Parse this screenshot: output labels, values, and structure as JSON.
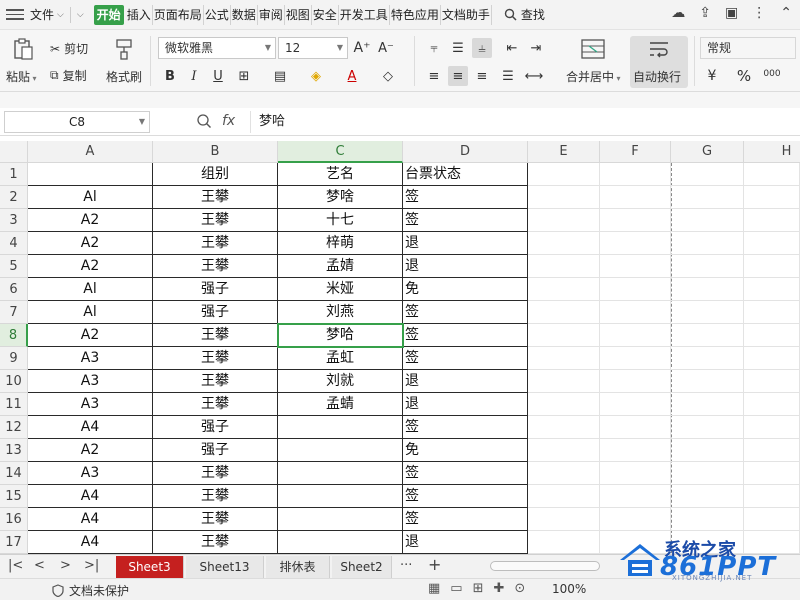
{
  "menubar": {
    "file_label": "文件",
    "tabs": [
      "开始",
      "插入",
      "页面布局",
      "公式",
      "数据",
      "审阅",
      "视图",
      "安全",
      "开发工具",
      "特色应用",
      "文档助手"
    ],
    "active_tab": "开始",
    "search_label": "查找"
  },
  "ribbon": {
    "paste_label": "粘贴",
    "cut_label": "剪切",
    "copy_label": "复制",
    "format_painter_label": "格式刷",
    "font_name": "微软雅黑",
    "font_size": "12",
    "merge_center_label": "合并居中",
    "auto_wrap_label": "自动换行",
    "number_format": "常规",
    "percent_symbol": "%",
    "thousand_symbol": "000"
  },
  "formula_bar": {
    "cell_ref": "C8",
    "fx_label": "fx",
    "content": "梦哈"
  },
  "grid": {
    "columns": [
      "A",
      "B",
      "C",
      "D",
      "E",
      "F",
      "G",
      "H"
    ],
    "selected_column": "C",
    "selected_row": 8,
    "rows": [
      {
        "num": "1",
        "a": "",
        "b": "组别",
        "c": "艺名",
        "d": "台票状态"
      },
      {
        "num": "2",
        "a": "Al",
        "b": "王攀",
        "c": "梦啥",
        "d": "签"
      },
      {
        "num": "3",
        "a": "A2",
        "b": "王攀",
        "c": "十七",
        "d": "签"
      },
      {
        "num": "4",
        "a": "A2",
        "b": "王攀",
        "c": "梓萌",
        "d": "退"
      },
      {
        "num": "5",
        "a": "A2",
        "b": "王攀",
        "c": "孟婧",
        "d": "退"
      },
      {
        "num": "6",
        "a": "Al",
        "b": "强子",
        "c": "米娅",
        "d": "免"
      },
      {
        "num": "7",
        "a": "Al",
        "b": "强子",
        "c": "刘燕",
        "d": "签"
      },
      {
        "num": "8",
        "a": "A2",
        "b": "王攀",
        "c": "梦哈",
        "d": "签"
      },
      {
        "num": "9",
        "a": "A3",
        "b": "王攀",
        "c": "孟虹",
        "d": "签"
      },
      {
        "num": "10",
        "a": "A3",
        "b": "王攀",
        "c": "刘就",
        "d": "退"
      },
      {
        "num": "11",
        "a": "A3",
        "b": "王攀",
        "c": "孟蜻",
        "d": "退"
      },
      {
        "num": "12",
        "a": "A4",
        "b": "强子",
        "c": "",
        "d": "签"
      },
      {
        "num": "13",
        "a": "A2",
        "b": "强子",
        "c": "",
        "d": "免"
      },
      {
        "num": "14",
        "a": "A3",
        "b": "王攀",
        "c": "",
        "d": "签"
      },
      {
        "num": "15",
        "a": "A4",
        "b": "王攀",
        "c": "",
        "d": "签"
      },
      {
        "num": "16",
        "a": "A4",
        "b": "王攀",
        "c": "",
        "d": "签"
      },
      {
        "num": "17",
        "a": "A4",
        "b": "王攀",
        "c": "",
        "d": "退"
      }
    ]
  },
  "sheets": {
    "tabs": [
      "Sheet3",
      "Sheet13",
      "排休表",
      "Sheet2"
    ],
    "active": "Sheet3",
    "more": "···",
    "add": "+"
  },
  "status": {
    "protection": "文档未保护",
    "zoom": "100%"
  },
  "watermark": {
    "brand": "系统之家",
    "number": "861PPT",
    "url": "XITONGZHIJIA.NET"
  },
  "colors": {
    "accent_green": "#36a04a",
    "active_sheet": "#c5201f",
    "watermark_blue": "#1c6fd8"
  }
}
